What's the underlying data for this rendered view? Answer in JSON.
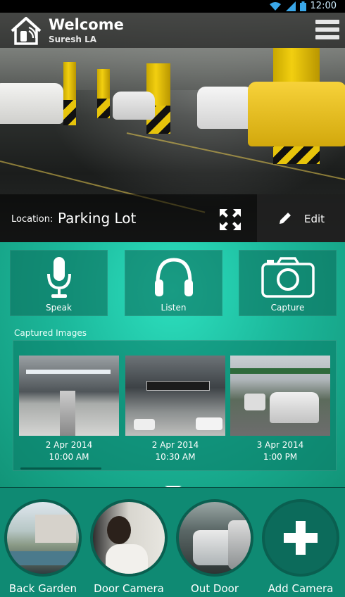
{
  "status_bar": {
    "time": "12:00",
    "icons": [
      "wifi-icon",
      "signal-icon",
      "battery-icon"
    ]
  },
  "header": {
    "title": "Welcome",
    "user": "Suresh LA",
    "menu_icon": "hamburger-menu-icon"
  },
  "camera_view": {
    "location_label": "Location:",
    "location_value": "Parking Lot",
    "expand_icon": "fullscreen-expand-icon",
    "edit_label": "Edit",
    "edit_icon": "pencil-icon"
  },
  "actions": [
    {
      "label": "Speak",
      "icon": "microphone-icon"
    },
    {
      "label": "Listen",
      "icon": "headphones-icon"
    },
    {
      "label": "Capture",
      "icon": "camera-icon"
    }
  ],
  "captured": {
    "title": "Captured Images",
    "items": [
      {
        "date": "2 Apr 2014",
        "time": "10:00 AM"
      },
      {
        "date": "2 Apr 2014",
        "time": "10:30 AM"
      },
      {
        "date": "3 Apr 2014",
        "time": "1:00 PM"
      }
    ]
  },
  "cameras": [
    {
      "label": "Back Garden"
    },
    {
      "label": "Door Camera"
    },
    {
      "label": "Out Door"
    },
    {
      "label": "Add Camera",
      "icon": "plus-icon"
    }
  ],
  "colors": {
    "teal": "#1cb99c",
    "dark_teal": "#0f8a73",
    "accent_yellow": "#f2cf10"
  }
}
